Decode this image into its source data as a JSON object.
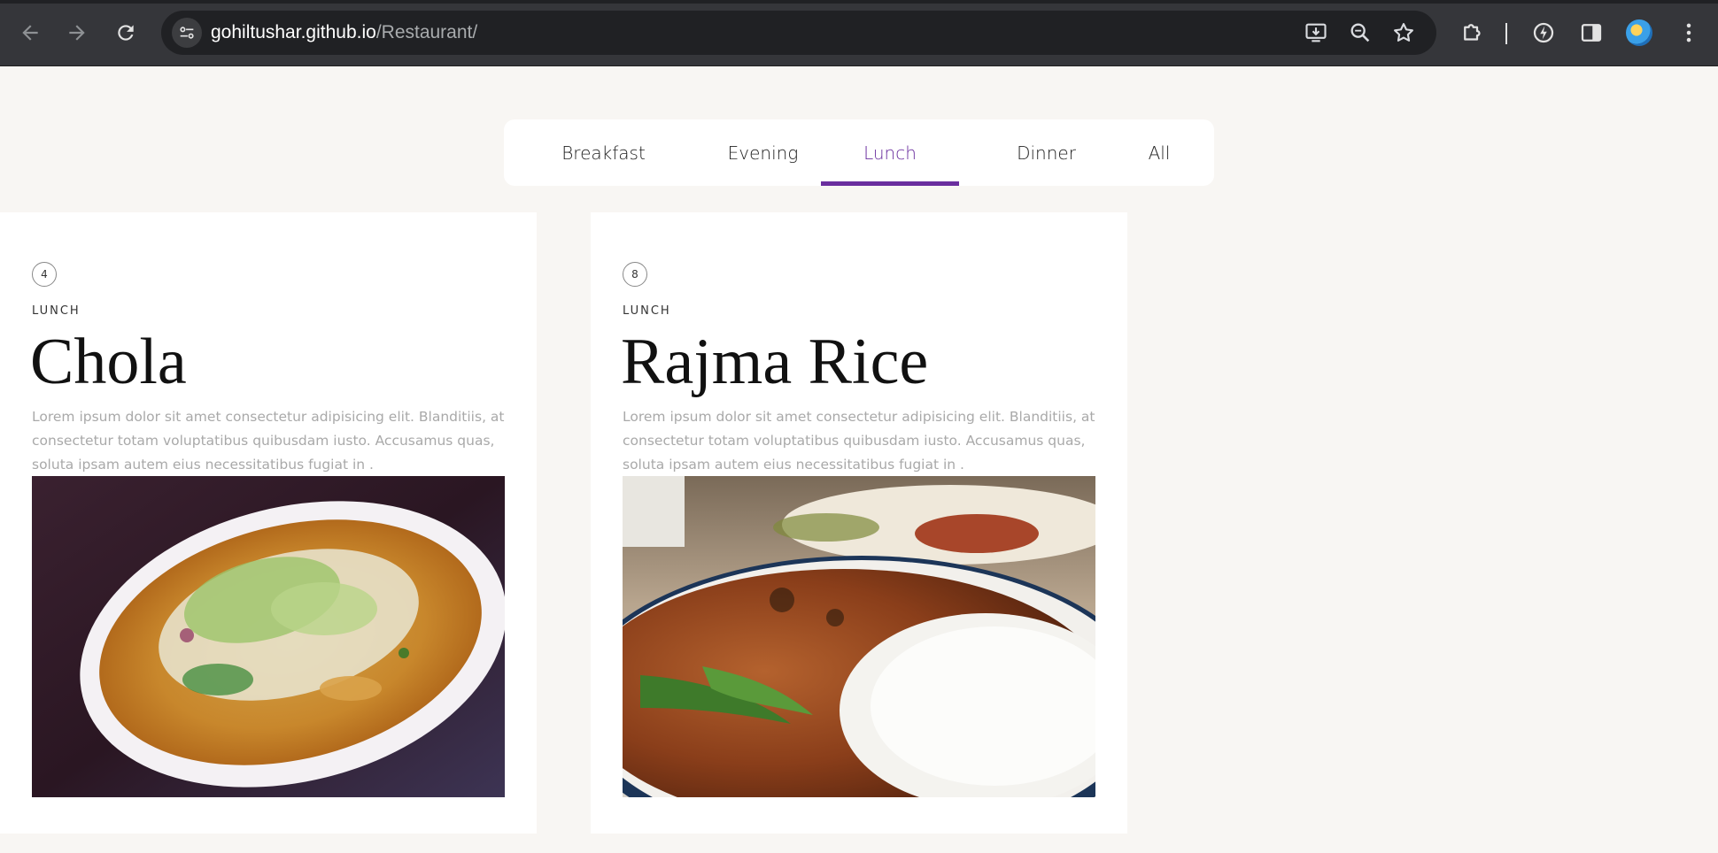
{
  "browser": {
    "url_host": "gohiltushar.github.io",
    "url_path": "/Restaurant/"
  },
  "menu": {
    "tabs": [
      {
        "label": "Breakfast"
      },
      {
        "label": "Evening"
      },
      {
        "label": "Lunch"
      },
      {
        "label": "Dinner"
      },
      {
        "label": "All"
      }
    ],
    "active_tab": "Lunch",
    "accent_color": "#6a2e9e"
  },
  "items": [
    {
      "id": "4",
      "category": "LUNCH",
      "name": "Chola",
      "description": "Lorem ipsum dolor sit amet consectetur adipisicing elit. Blanditiis, at consectetur totam voluptatibus quibusdam iusto. Accusamus quas, soluta ipsam autem eius necessitatibus fugiat in ."
    },
    {
      "id": "8",
      "category": "LUNCH",
      "name": "Rajma Rice",
      "description": "Lorem ipsum dolor sit amet consectetur adipisicing elit. Blanditiis, at consectetur totam voluptatibus quibusdam iusto. Accusamus quas, soluta ipsam autem eius necessitatibus fugiat in ."
    }
  ]
}
